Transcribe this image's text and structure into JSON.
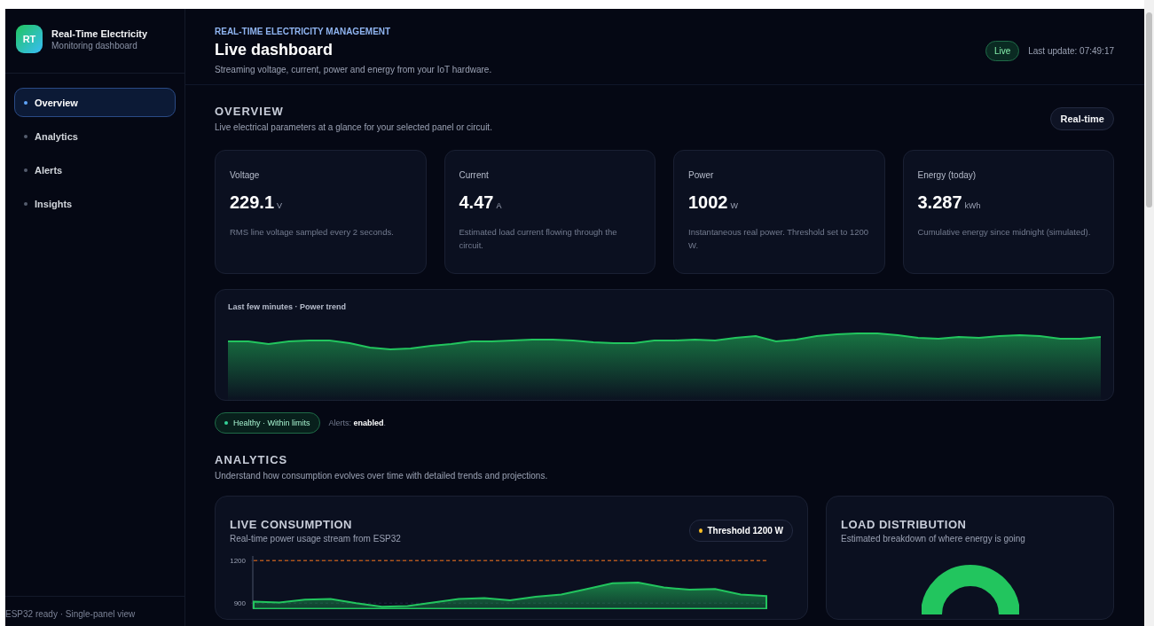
{
  "sidebar": {
    "logo": "RT",
    "title": "Real-Time Electricity",
    "subtitle": "Monitoring dashboard",
    "items": [
      {
        "label": "Overview",
        "selected": true
      },
      {
        "label": "Analytics",
        "selected": false
      },
      {
        "label": "Alerts",
        "selected": false
      },
      {
        "label": "Insights",
        "selected": false
      }
    ],
    "footer": "ESP32 ready · Single-panel view"
  },
  "header": {
    "eyebrow": "REAL-TIME ELECTRICITY MANAGEMENT",
    "title": "Live dashboard",
    "subtitle": "Streaming voltage, current, power and energy from your IoT hardware.",
    "live_badge": "Live",
    "last_update": "Last update: 07:49:17"
  },
  "overview": {
    "title": "OVERVIEW",
    "subtitle": "Live electrical parameters at a glance for your selected panel or circuit.",
    "mode_button": "Real-time",
    "cards": [
      {
        "label": "Voltage",
        "value": "229.1",
        "unit": "V",
        "note": "RMS line voltage sampled every 2 seconds."
      },
      {
        "label": "Current",
        "value": "4.47",
        "unit": "A",
        "note": "Estimated load current flowing through the circuit."
      },
      {
        "label": "Power",
        "value": "1002",
        "unit": "W",
        "note": "Instantaneous real power. Threshold set to 1200 W."
      },
      {
        "label": "Energy (today)",
        "value": "3.287",
        "unit": "kWh",
        "note": "Cumulative energy since midnight (simulated)."
      }
    ],
    "trend_title": "Last few minutes · Power trend",
    "status": "Healthy · Within limits",
    "alerts_text": "Alerts: **enabled**."
  },
  "analytics": {
    "title": "ANALYTICS",
    "subtitle": "Understand how consumption evolves over time with detailed trends and projections.",
    "live": {
      "title": "LIVE CONSUMPTION",
      "subtitle": "Real-time power usage stream from ESP32",
      "chart_data": {
        "type": "area",
        "ylim": [
          860,
          1220
        ],
        "yticks": [
          900,
          1200
        ],
        "series": [
          {
            "color": "#22c55e",
            "values": [
              910,
              905,
              925,
              930,
              900,
              875,
              880,
              905,
              930,
              935,
              920,
              945,
              960,
              1000,
              1040,
              1045,
              1010,
              995,
              1000,
              960,
              950
            ]
          },
          {
            "name": "Threshold 1200 W",
            "type": "line",
            "line_style": "dashed",
            "color": "#f97316",
            "values": [
              1200,
              1200,
              1200,
              1200,
              1200,
              1200,
              1200,
              1200,
              1200,
              1200,
              1200,
              1200,
              1200,
              1200,
              1200,
              1200,
              1200,
              1200,
              1200,
              1200,
              1200
            ]
          }
        ]
      }
    },
    "distribution": {
      "title": "LOAD DISTRIBUTION",
      "subtitle": "Estimated breakdown of where energy is going"
    }
  }
}
